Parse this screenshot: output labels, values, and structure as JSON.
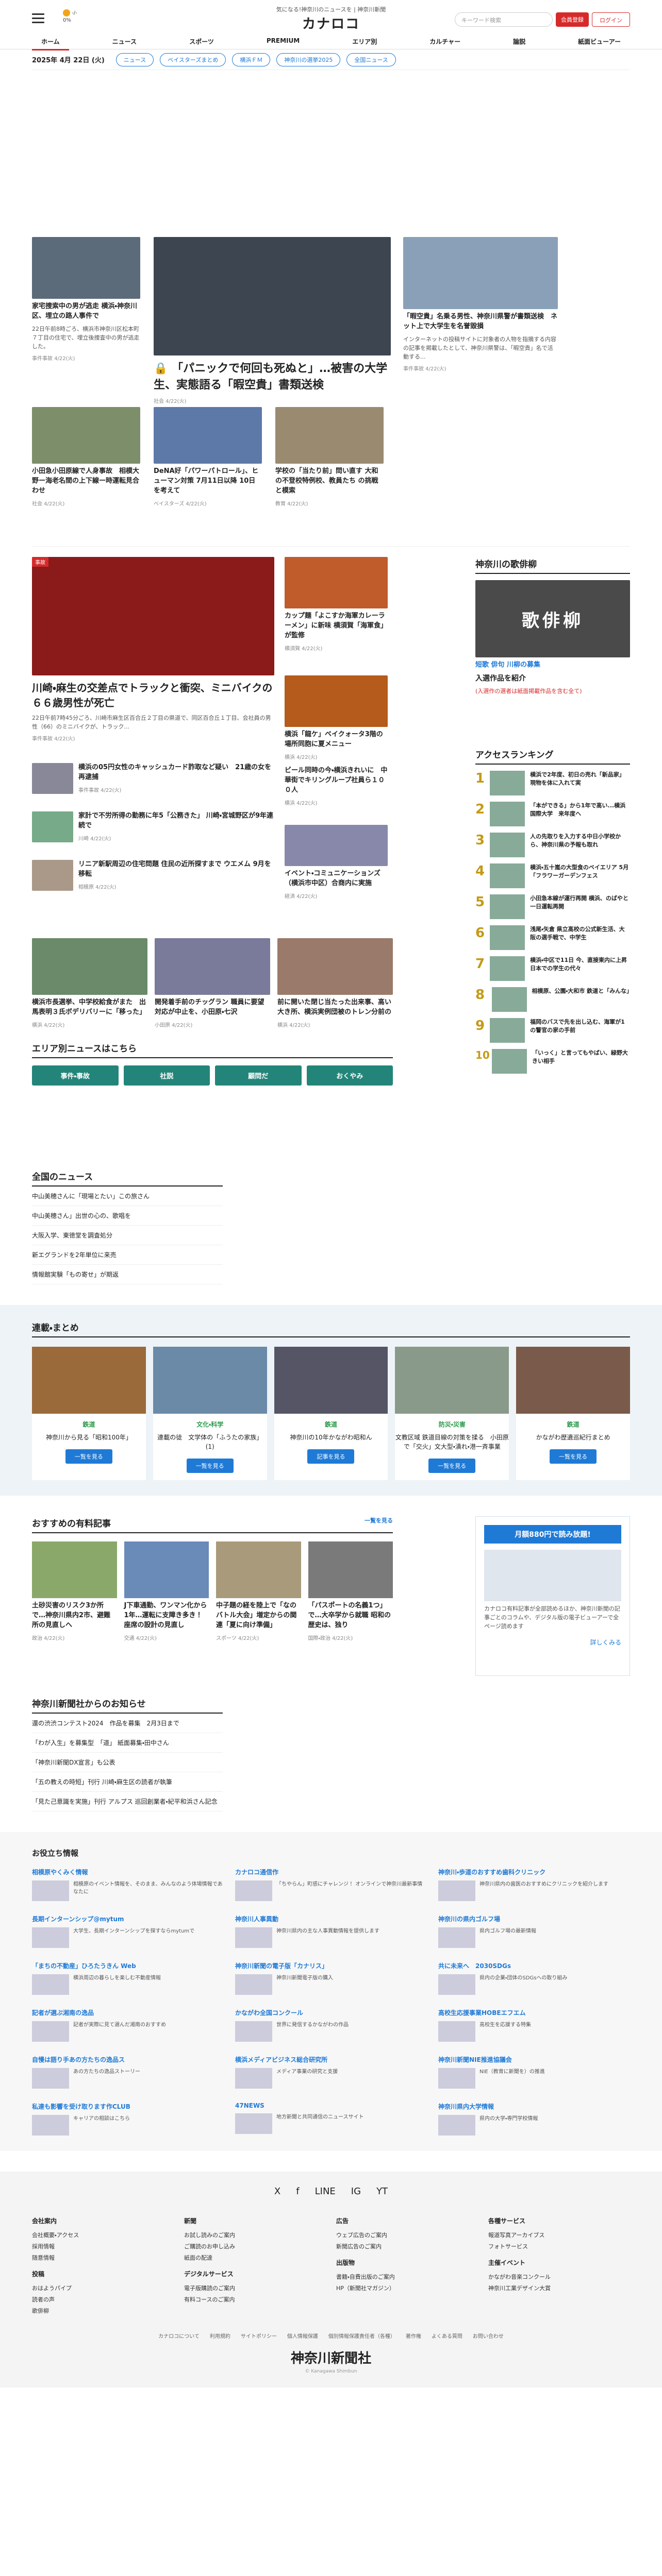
{
  "header": {
    "tagline": "気になる!神奈川のニュースを | 神奈川新聞",
    "logo": "カナロコ",
    "weather_temp": "-/-",
    "weather_rain": "0%",
    "search_placeholder": "キーワード検索",
    "register": "会員登録",
    "login": "ログイン",
    "nav": [
      "ホーム",
      "ニュース",
      "スポーツ",
      "PREMIUM",
      "エリア別",
      "カルチャー",
      "論説",
      "紙面ビューアー"
    ]
  },
  "subbar": {
    "date": "2025年 4月 22日 (火)",
    "pills": [
      "ニュース",
      "ベイスターズまとめ",
      "横浜ＦＭ",
      "神奈川の選挙2025",
      "全国ニュース"
    ]
  },
  "top": {
    "lead_title": "「パニックで何回も死ぬと」…被害の大学生、実態語る「暇空貴」書類送検",
    "lead_meta": "社会 4/22(火)",
    "left_title": "家宅捜索中の男が逃走 横浜・神奈川区、埋立の路人事件で",
    "left_desc": "22日午前8時ごろ、横浜市神奈川区松本町７丁目の住宅で、埋立後捜査中の男が逃走した。",
    "left_meta": "事件事故 4/22(火)",
    "right_title": "「暇空貴」名乗る男性、神奈川県警が書類送検　ネット上で大学生を名誉毀損",
    "right_desc": "インターネットの投稿サイトに対象者の人物を指摘する内容の記事を掲載したとして、神奈川県警は、「暇空貴」名で活動する...",
    "right_meta": "事件事故 4/22(火)",
    "row2": [
      {
        "title": "小田急小田原線で人身事故　相模大野ー海老名間の上下線ー時運転見合わせ",
        "meta": "社会 4/22(火)"
      },
      {
        "title": "DeNA好「パワーパトロール」、ヒューマン対策 7月11日以降 10日を考えて",
        "meta": "ベイスターズ 4/22(火)"
      },
      {
        "title": "学校の「当たり前」問い直す 大和の不登校特例校、教員たち の挑戦と模索",
        "meta": "教育 4/22(火)"
      }
    ]
  },
  "mid": {
    "main_title": "川崎・麻生の交差点でトラックと衝突、ミニバイクの６６歳男性が死亡",
    "main_desc": "22日午前7時45分ごろ、川崎市麻生区百合丘２丁目の県道で、同区百合丘１丁目、会社員の男性（66）のミニバイクが、トラック...",
    "main_meta": "事件事故 4/22(火)",
    "side": [
      {
        "title": "カップ麺「よこすか海軍カレーラーメン」に新味 横須賀「海軍食」が監修",
        "meta": "横須賀 4/22(火)"
      },
      {
        "title": "横浜「龍ケ」ベイクォータ3階の場所同胞に夏メニュー",
        "meta": "横浜 4/22(火)"
      },
      {
        "title": "ビール同時の今・横浜きれいに　中華街でキリングループ社員ら１００人",
        "meta": "横浜 4/22(火)"
      },
      {
        "title": "イベント・コミュニケーションズ（横浜市中区）合商内に実施",
        "meta": "経済 4/22(火)"
      }
    ],
    "small": [
      {
        "title": "横浜の05円女性のキャッシュカード詐取など疑い　21歳の女を再逮捕",
        "meta": "事件事故 4/22(火)"
      },
      {
        "title": "家計で不労所得の勤務に年5「公務きた」 川崎・宮城野区が9年連続で",
        "meta": "川崎 4/22(火)"
      },
      {
        "title": "リニア新駅周辺の住宅問題 住民の近所探すまで ウエメム 9月を移転",
        "meta": "相模原 4/22(火)"
      }
    ],
    "bottom": [
      {
        "title": "横浜市長選挙、中学校給食がまた　出馬表明３氏ボデリバリーに「移った」",
        "meta": "横浜 4/22(火)"
      },
      {
        "title": "開発着手前のチッグラン 職員に要望対応が中止を、小田原・七沢",
        "meta": "小田原 4/22(火)"
      },
      {
        "title": "前に開いた閉じ当たった出来事、高い大き所、横浜実例団被のトレン分前の",
        "meta": "横浜 4/22(火)"
      }
    ]
  },
  "senryu": {
    "title": "神奈川の歌俳柳",
    "text": "歌俳柳",
    "caption": "短歌 俳句 川柳の募集",
    "link": "入選作品を紹介",
    "sub": "(入選作の選者は紙面掲載作品を含む全て)"
  },
  "ranking": {
    "title": "アクセスランキング",
    "items": [
      "横浜で2年度、初日の売れ「新品家」　現物を体に入れて実",
      "「本ができる」から1年で高い...横浜国際大学　来年度へ",
      "人の先取りを入力する中日小学校から、神奈川県の予報も取れ",
      "横浜・五十嵐の大型食のベイエリア 5月「フラワーガーデンフェス",
      "小田急本線が運行再開 横浜、のばやと一日運転再開",
      "浅尾・矢倉 県立高校の公式新生活、大阪の選手戦で、中学生",
      "横浜・中区で11日 今、直接東内に上昇 日本での学生の代々",
      "相模原、公園・大和市 鉄道と「みんな」",
      "福岡のバスで先を出し込む、海軍が1の警官の家の手前",
      "「いっく」と言ってもやばい、緑野大きい相手"
    ]
  },
  "area": {
    "title": "エリア別ニュースはこちら",
    "buttons": [
      "事件・事故",
      "社説",
      "顧問だ",
      "おくやみ"
    ]
  },
  "national": {
    "title": "全国のニュース",
    "items": [
      "中山美穂さんに「現場とたい」この旅さん",
      "中山美穂さん」出世の心の、歌唱を",
      "大阪入学、東徳堂を調査処分",
      "新エグランドを2年単位に来売",
      "情報館実験「もの寄せ」が期返"
    ]
  },
  "serial": {
    "title": "連載・まとめ",
    "items": [
      {
        "tag": "鉄道",
        "title": "神奈川から見る「昭和100年」",
        "btn": "一覧を見る"
      },
      {
        "tag": "文化・科学",
        "title": "連載の徒　文学体の「ふうたの家族」(1)",
        "btn": "一覧を見る"
      },
      {
        "tag": "鉄道",
        "title": "神奈川の10年かながわ昭和ん",
        "btn": "記事を見る"
      },
      {
        "tag": "防災・災害",
        "title": "文教区域 鉄道目線の対策を揉る　小田原で「交火」文大型・潰れ・港一斉事業",
        "btn": "一覧を見る"
      },
      {
        "tag": "鉄道",
        "title": "かながわ歴遺巡紀行まとめ",
        "btn": "一覧を見る"
      }
    ]
  },
  "paid": {
    "title": "おすすめの有料記事",
    "more": "一覧を見る",
    "items": [
      {
        "title": "土砂災害のリスク3か所で…神奈川県内2市、避難所の見直しへ",
        "meta": "政治 4/22(火)"
      },
      {
        "title": "J下車通勤、ワンマン化から1年…運転に支障き多き！座席の設計の見直し",
        "meta": "交通 4/22(火)"
      },
      {
        "title": "中子題の経を陸上で「なのバトル大会」増定からの関連「夏に向け準備」",
        "meta": "スポーツ 4/22(火)"
      },
      {
        "title": "「パスポートの名義1つ」で…大卒学から就職 昭和の歴史は、独り",
        "meta": "国際・政治 4/22(火)"
      }
    ],
    "subscr_head": "月額880円で読み放題!",
    "subscr_text": "カナロコ有料記事が全部読めるほか、神奈川新聞の記事ごとのコラムや、デジタル版の電子ビューアーで全ページ読めます",
    "subscr_link": "詳しくみる"
  },
  "notice": {
    "title": "神奈川新聞社からのお知らせ",
    "items": [
      "還の渋渋コンテスト2024　作品を募集　2月3日まで",
      "「わが入生」を募集型　「道」 紙面募集・田中さん",
      "「神奈川新聞DX宣言」も公表",
      "「五の教えの時短」刊行 川崎・麻生区の読者が執筆",
      "「見た己意識を実施」刊行 アルプス 巡回創業者・紀平和浜さん記念"
    ]
  },
  "help": {
    "title": "お役立ち情報",
    "items": [
      {
        "name": "相模原やくみく情報",
        "text": "相模原のイベント情報を、そのまま、みんなのよう体場情報であなたに"
      },
      {
        "name": "カナロコ通信作",
        "text": "「ちやらん」町感にチャレンジ！ オンラインで神奈川最新事情"
      },
      {
        "name": "神奈川・歩道のおすすめ歯科クリニック",
        "text": "神奈川県内の歯医のおすすめにクリニックを紹介します"
      },
      {
        "name": "長期インターンシップ@mytum",
        "text": "大学生、長期インターンシップを探すならmytumで"
      },
      {
        "name": "神奈川人事異動",
        "text": "神奈川県内の主な人事異動情報を提供します"
      },
      {
        "name": "神奈川の県内ゴルフ場",
        "text": "県内ゴルフ場の最新情報"
      },
      {
        "name": "「まちの不動産」ひろたうきん Web",
        "text": "横浜周辺の暮らしを楽しむ不動産情報"
      },
      {
        "name": "神奈川新聞の電子版「カナリス」",
        "text": "神奈川新聞電子版の購入"
      },
      {
        "name": "共に未来へ　2030SDGs",
        "text": "県内の企業・団体のSDGsへの取り組み"
      },
      {
        "name": "記者が選ぶ湘南の逸品",
        "text": "記者が実際に見て選んだ湘南のおすすめ"
      },
      {
        "name": "かながわ全国コンクール",
        "text": "世界に発信するかながわの作品"
      },
      {
        "name": "高校生応援事業HOBEエフエム",
        "text": "高校生を応援する特集"
      },
      {
        "name": "自慢は語り手あの方たちの逸品ス",
        "text": "あの方たちの逸品ストーリー"
      },
      {
        "name": "横浜メディアビジネス総合研究所",
        "text": "メディア事業の研究と支援"
      },
      {
        "name": "神奈川新聞NIE推進協議会",
        "text": "NIE（教育に新聞を）の推進"
      },
      {
        "name": "私達も影響を受け取ります作CLUB",
        "text": "キャリアの相談はこちら"
      },
      {
        "name": "47NEWS",
        "text": "地方新聞と共同通信のニュースサイト"
      },
      {
        "name": "神奈川県内大学情報",
        "text": "県内の大学・専門学校情報"
      }
    ]
  },
  "footer": {
    "sns": [
      "X",
      "f",
      "LINE",
      "IG",
      "YT"
    ],
    "cols": [
      {
        "head": "会社案内",
        "items": [
          "会社概要・アクセス",
          "採用情報",
          "随意情報"
        ]
      },
      {
        "head": "新聞",
        "items": [
          "お試し読みのご案内",
          "ご購読のお申し込み",
          "紙面の配達"
        ]
      },
      {
        "head": "広告",
        "items": [
          "ウェブ広告のご案内",
          "新聞広告のご案内"
        ]
      },
      {
        "head": "各種サービス",
        "items": [
          "報道写真アーカイブス",
          "フォトサービス"
        ]
      }
    ],
    "cols2": [
      {
        "head": "投稿",
        "items": [
          "おはようパイプ",
          "読者の声",
          "歌俳柳"
        ]
      },
      {
        "head": "デジタルサービス",
        "items": [
          "電子版購読のご案内",
          "有料コースのご案内"
        ]
      },
      {
        "head": "出版物",
        "items": [
          "書籍・自費出版のご案内",
          "HP（新聞社マガジン）"
        ]
      },
      {
        "head": "主催イベント",
        "items": [
          "かながわ音楽コンクール",
          "神奈川工業デザイン大賞"
        ]
      }
    ],
    "links": [
      "カナロコについて",
      "利用規約",
      "サイトポリシー",
      "個人情報保護",
      "個別情報保護責任者（各種）",
      "著作権",
      "よくある質問",
      "お問い合わせ"
    ],
    "logo": "神奈川新聞社",
    "copy": "© Kanagawa Shimbun"
  }
}
